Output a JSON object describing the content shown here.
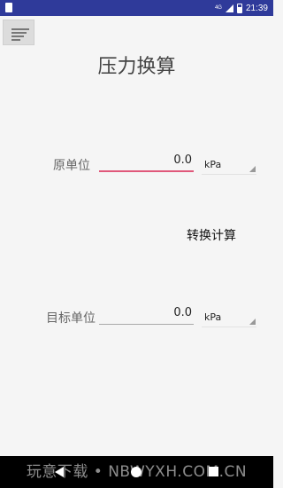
{
  "status_bar": {
    "network": "4G",
    "time": "21:39"
  },
  "title": "压力换算",
  "source": {
    "label": "原单位",
    "value": "0.0",
    "unit": "kPa"
  },
  "convert_button": "转换计算",
  "target": {
    "label": "目标单位",
    "value": "0.0",
    "unit": "kPa"
  },
  "watermark": "玩意下载 • NBWYXH.COM.CN",
  "colors": {
    "status_bar": "#2f3a9a",
    "accent": "#e0587a",
    "background": "#f5f5f5"
  }
}
